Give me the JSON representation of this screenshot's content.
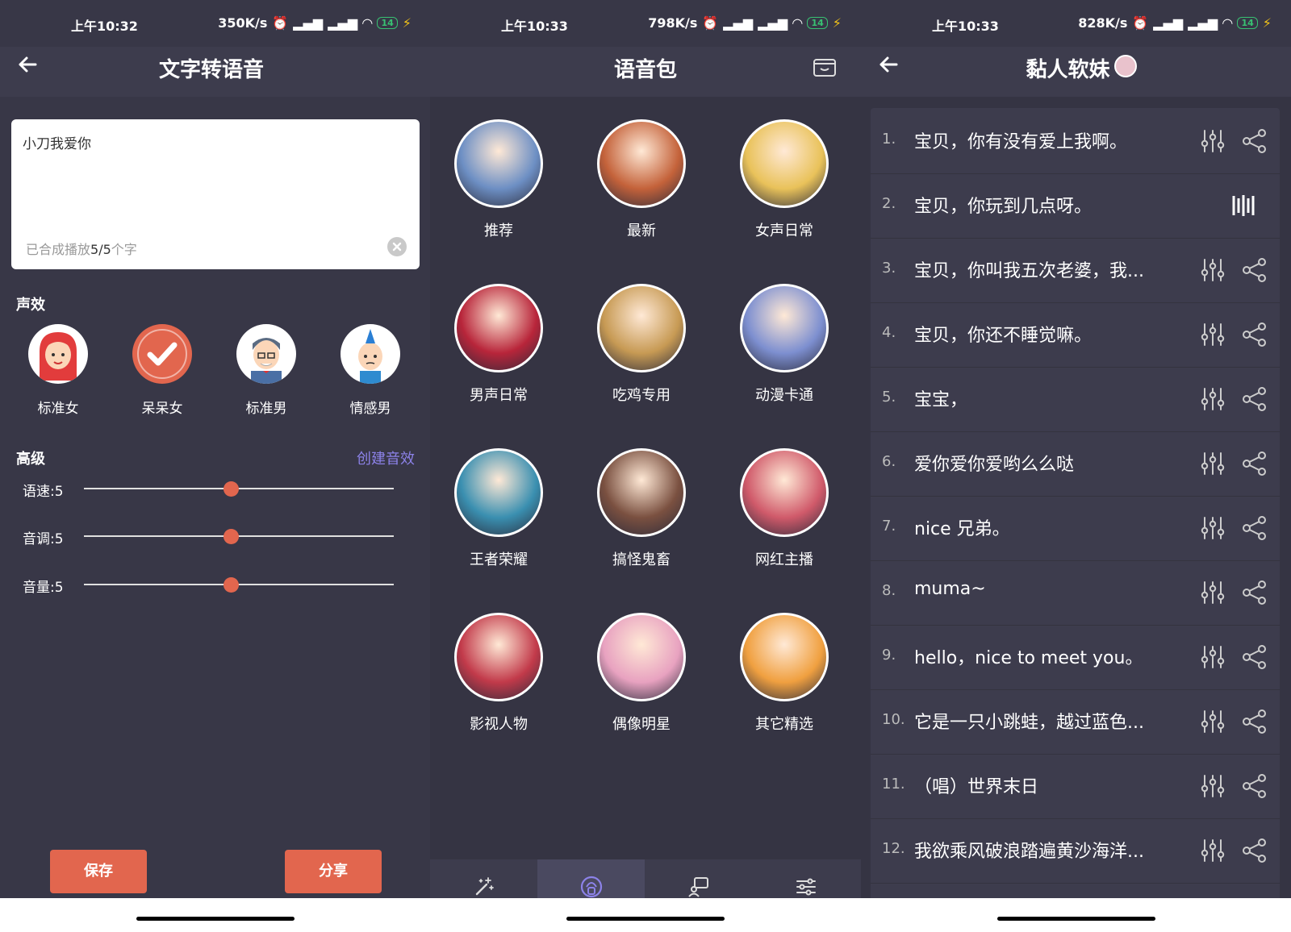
{
  "panel1": {
    "status": {
      "time": "上午10:32",
      "speed": "350K/s",
      "battery": "14"
    },
    "title": "文字转语音",
    "input_text": "小刀我爱你",
    "count_prefix": "已合成播放",
    "count_value": "5/5",
    "count_suffix": "个字",
    "effects_title": "声效",
    "voices": [
      {
        "label": "标准女"
      },
      {
        "label": "呆呆女",
        "selected": true
      },
      {
        "label": "标准男"
      },
      {
        "label": "情感男"
      }
    ],
    "advanced_title": "高级",
    "create_label": "创建音效",
    "sliders": [
      {
        "label": "语速:5",
        "value": 0.5
      },
      {
        "label": "音调:5",
        "value": 0.5
      },
      {
        "label": "音量:5",
        "value": 0.5
      }
    ],
    "save_label": "保存",
    "share_label": "分享"
  },
  "panel2": {
    "status": {
      "time": "上午10:33",
      "speed": "798K/s",
      "battery": "14"
    },
    "title": "语音包",
    "categories": [
      {
        "label": "推荐",
        "color": "#6d8fc4"
      },
      {
        "label": "最新",
        "color": "#c4623a"
      },
      {
        "label": "女声日常",
        "color": "#e9c25a"
      },
      {
        "label": "男声日常",
        "color": "#b8253a"
      },
      {
        "label": "吃鸡专用",
        "color": "#c79a54"
      },
      {
        "label": "动漫卡通",
        "color": "#7d8fd0"
      },
      {
        "label": "王者荣耀",
        "color": "#3a8fb0"
      },
      {
        "label": "搞怪鬼畜",
        "color": "#7a5040"
      },
      {
        "label": "网红主播",
        "color": "#d05a6a"
      },
      {
        "label": "影视人物",
        "color": "#c23a4a"
      },
      {
        "label": "偶像明星",
        "color": "#e8a2c0"
      },
      {
        "label": "其它精选",
        "color": "#f0a040"
      }
    ],
    "tabs": [
      "magic-wand-icon",
      "voice-pack-icon",
      "chat-icon",
      "settings-icon"
    ],
    "active_tab": 1
  },
  "panel3": {
    "status": {
      "time": "上午10:33",
      "speed": "828K/s",
      "battery": "14"
    },
    "title": "黏人软妹",
    "items": [
      {
        "num": "1.",
        "text": "宝贝，你有没有爱上我啊。"
      },
      {
        "num": "2.",
        "text": "宝贝，你玩到几点呀。",
        "playing": true
      },
      {
        "num": "3.",
        "text": "宝贝，你叫我五次老婆，我..."
      },
      {
        "num": "4.",
        "text": "宝贝，你还不睡觉嘛。"
      },
      {
        "num": "5.",
        "text": "宝宝，"
      },
      {
        "num": "6.",
        "text": "爱你爱你爱哟么么哒"
      },
      {
        "num": "7.",
        "text": "nice 兄弟。"
      },
      {
        "num": "8.",
        "text": "muma~"
      },
      {
        "num": "9.",
        "text": "hello，nice to meet you。"
      },
      {
        "num": "10.",
        "text": "它是一只小跳蛙，越过蓝色..."
      },
      {
        "num": "11.",
        "text": "（唱）世界末日"
      },
      {
        "num": "12.",
        "text": "我欲乘风破浪踏遍黄沙海洋..."
      }
    ]
  },
  "colors": {
    "accent": "#e2664e",
    "link": "#8c82e8",
    "bg": "#383747"
  }
}
